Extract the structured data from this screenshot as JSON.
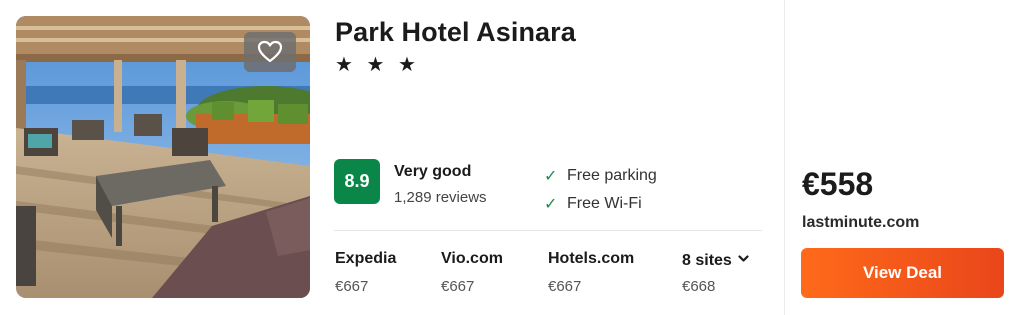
{
  "hotel": {
    "name": "Park Hotel Asinara",
    "stars": "★ ★ ★"
  },
  "rating": {
    "score": "8.9",
    "label": "Very good",
    "reviews": "1,289 reviews",
    "color": "#0a8748"
  },
  "amenities": [
    {
      "label": "Free parking",
      "icon": "check-icon"
    },
    {
      "label": "Free Wi-Fi",
      "icon": "check-icon"
    }
  ],
  "sites": [
    {
      "name": "Expedia",
      "price": "€667"
    },
    {
      "name": "Vio.com",
      "price": "€667"
    },
    {
      "name": "Hotels.com",
      "price": "€667"
    },
    {
      "name": "8 sites",
      "price": "€668"
    }
  ],
  "deal": {
    "price": "€558",
    "provider": "lastminute.com",
    "button_label": "View Deal",
    "button_color": "#f05a1c"
  },
  "icons": {
    "favorite": "heart-icon",
    "more_sites": "chevron-down-icon"
  }
}
